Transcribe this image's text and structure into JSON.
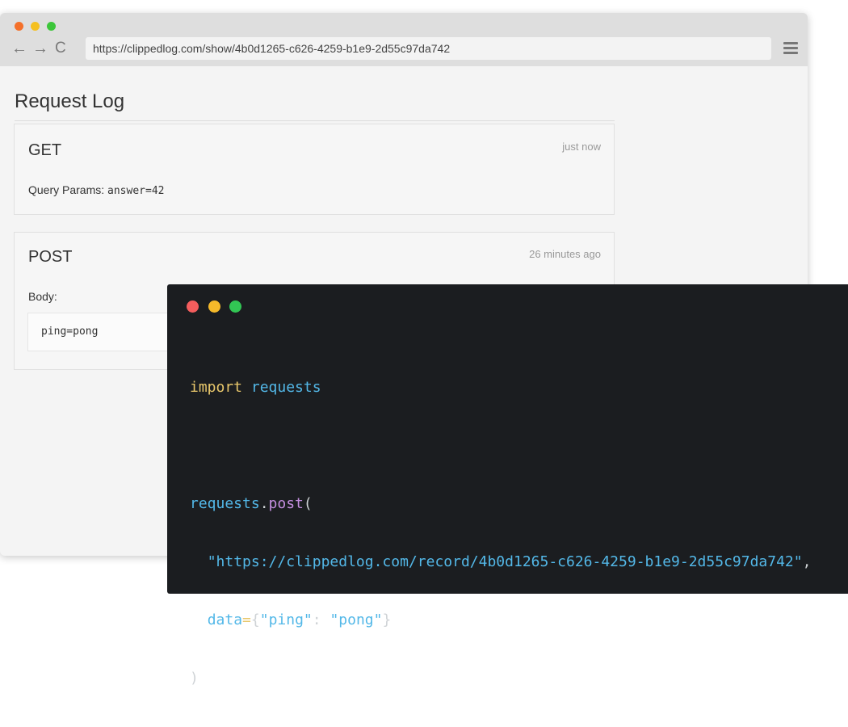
{
  "browser": {
    "url": "https://clippedlog.com/show/4b0d1265-c626-4259-b1e9-2d55c97da742",
    "back_glyph": "←",
    "forward_glyph": "→",
    "reload_glyph": "C",
    "colors": {
      "close": "#f4702a",
      "minimize": "#f5c020",
      "maximize": "#3cc63a"
    }
  },
  "page": {
    "title": "Request Log",
    "requests": [
      {
        "method": "GET",
        "time": "just now",
        "param_label": "Query Params:",
        "param_value": "answer=42"
      },
      {
        "method": "POST",
        "time": "26 minutes ago",
        "body_label": "Body:",
        "body_value": "ping=pong"
      }
    ]
  },
  "terminal": {
    "colors": {
      "close": "#f45d5d",
      "minimize": "#f5b92a",
      "maximize": "#32c654"
    },
    "code": {
      "import_kw": "import",
      "import_mod": "requests",
      "call_obj": "requests",
      "call_dot": ".",
      "call_fn": "post",
      "call_open": "(",
      "indent": "  ",
      "url_string": "\"https://clippedlog.com/record/4b0d1265-c626-4259-b1e9-2d55c97da742\"",
      "comma": ",",
      "data_kw": "data",
      "eq": "=",
      "brace_open": "{",
      "key": "\"ping\"",
      "colon": ": ",
      "val": "\"pong\"",
      "brace_close": "}",
      "call_close": ")"
    }
  }
}
